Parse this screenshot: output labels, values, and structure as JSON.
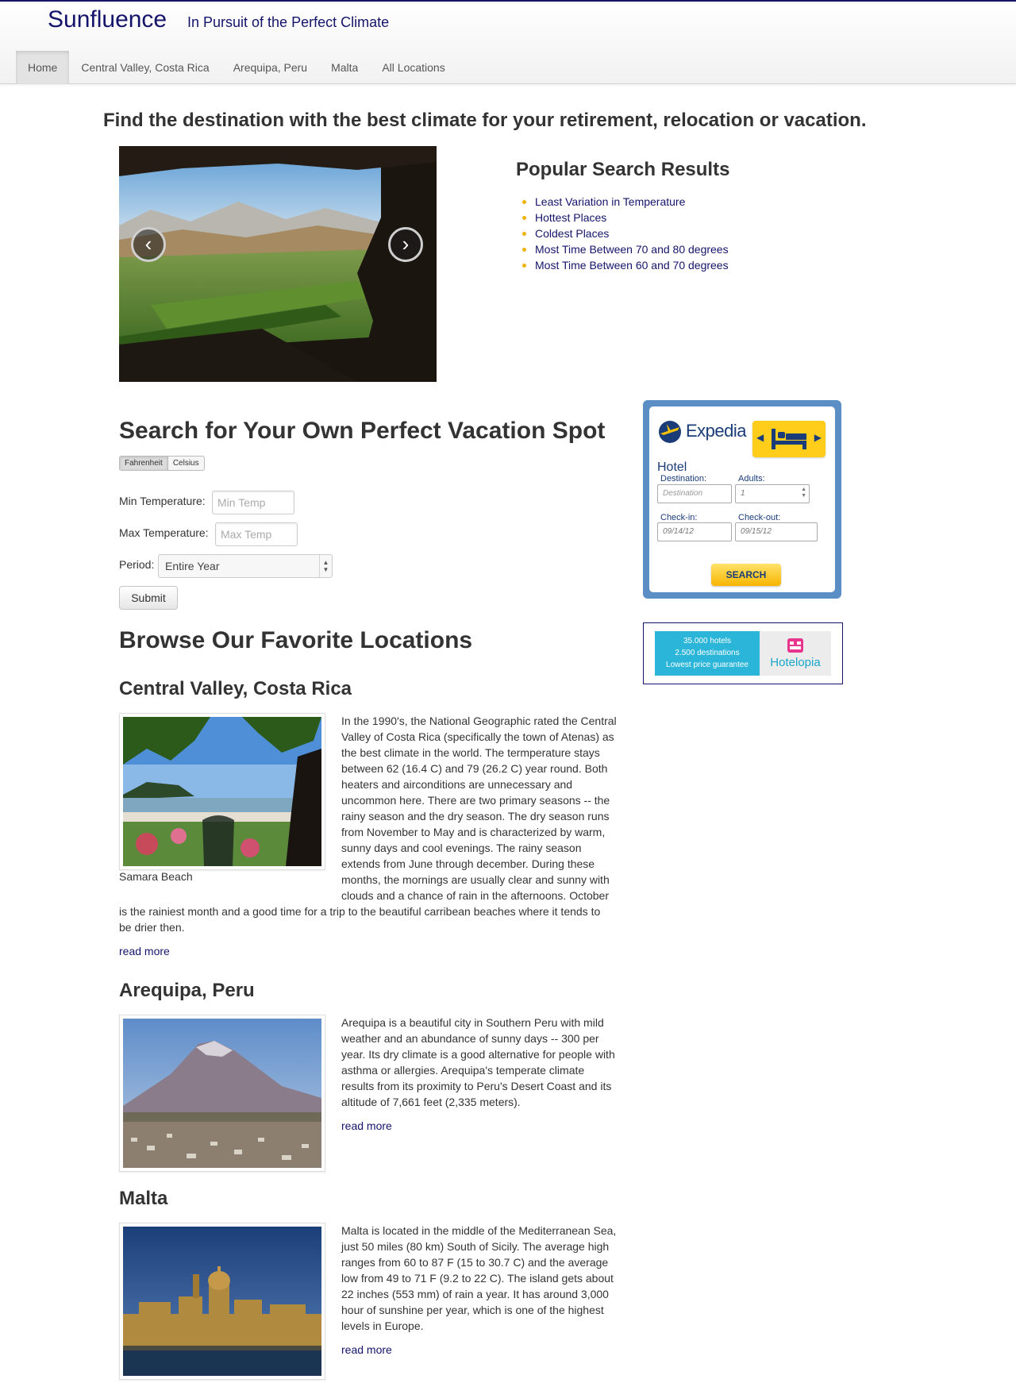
{
  "navbar": {
    "brand": "Sunfluence",
    "tagline": "In Pursuit of the Perfect Climate",
    "items": [
      {
        "label": "Home",
        "active": true
      },
      {
        "label": "Central Valley, Costa Rica"
      },
      {
        "label": "Arequipa, Peru"
      },
      {
        "label": "Malta"
      },
      {
        "label": "All Locations"
      }
    ]
  },
  "headline": "Find the destination with the best climate for your retirement, relocation or vacation.",
  "carousel": {
    "prev_icon": "chevron-left-icon",
    "next_icon": "chevron-right-icon",
    "prev_glyph": "‹",
    "next_glyph": "›"
  },
  "popular": {
    "title": "Popular Search Results",
    "links": [
      "Least Variation in Temperature",
      "Hottest Places",
      "Coldest Places",
      "Most Time Between 70 and 80 degrees",
      "Most Time Between 60 and 70 degrees"
    ]
  },
  "search": {
    "title": "Search for Your Own Perfect Vacation Spot",
    "units": [
      "Fahrenheit",
      "Celsius"
    ],
    "min_label": "Min Temperature:",
    "min_placeholder": "Min Temp",
    "max_label": "Max Temperature:",
    "max_placeholder": "Max Temp",
    "period_label": "Period:",
    "period_value": "Entire Year",
    "submit": "Submit"
  },
  "expedia": {
    "brand": "Expedia",
    "section": "Hotel",
    "destination_label": "Destination:",
    "destination_placeholder": "Destination",
    "adults_label": "Adults:",
    "adults_value": "1",
    "checkin_label": "Check-in:",
    "checkin_value": "09/14/12",
    "checkout_label": "Check-out:",
    "checkout_value": "09/15/12",
    "search_label": "SEARCH"
  },
  "hotelopia": {
    "line1": "35.000 hotels",
    "line2": "2.500 destinations",
    "line3": "Lowest price guarantee",
    "brand": "Hotelopia"
  },
  "browse": {
    "title": "Browse Our Favorite Locations",
    "read_more": "read more",
    "locations": [
      {
        "name": "Central Valley, Costa Rica",
        "caption": "Samara Beach",
        "lines": [
          "In the 1990's, the National Geographic rated the Central",
          "Valley of Costa Rica (specifically the town of Atenas) as",
          "the best climate in the world.  The termperature stays",
          "between 62 (16.4 C) and 79 (26.2 C) year round.  Both",
          "heaters and airconditions are unnecessary and",
          "uncommon here.  There are two primary seasons -- the",
          "rainy season and the dry season.  The dry season runs",
          "from November to May and is characterized by warm,",
          "sunny days and cool evenings.  The rainy season",
          "extends from June through december. During these",
          "months, the mornings are usually clear and sunny with",
          "clouds and a chance of rain in the afternoons.  October",
          "is the rainiest month and a good time for a trip to the beautiful carribean beaches where it tends to",
          "be drier then."
        ]
      },
      {
        "name": "Arequipa, Peru",
        "lines": [
          "Arequipa is a beautiful city in Southern Peru with mild",
          "weather and an abundance of sunny days -- 300 per",
          "year.  Its dry climate is a good alternative for people with",
          "asthma or allergies.  Arequipa's temperate climate",
          "results from its proximity to Peru's Desert Coast and its",
          "altitude of 7,661 feet (2,335 meters)."
        ]
      },
      {
        "name": "Malta",
        "lines": [
          "Malta is located in the middle of the Mediterranean Sea,",
          "just 50 miles (80 km) South of Sicily.  The average high",
          "ranges from 60 to 87 F (15 to 30.7 C) and the average",
          "low from 49 to 71 F (9.2 to 22 C).  The island gets about",
          "22 inches (553 mm) of rain a year.  It has around 3,000",
          "hour of sunshine per year, which is one of the highest",
          "levels in Europe."
        ]
      }
    ]
  }
}
